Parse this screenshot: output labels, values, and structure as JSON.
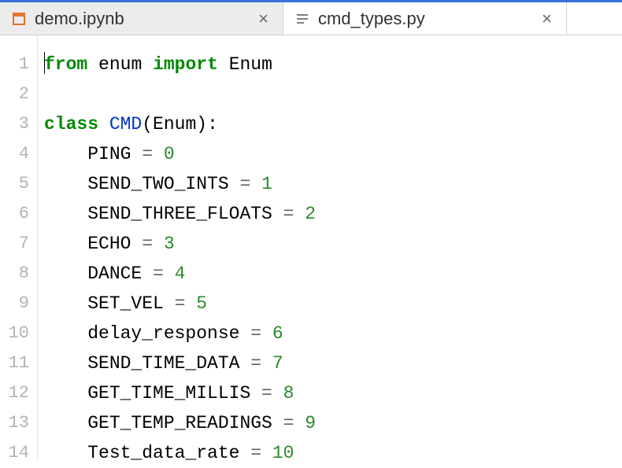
{
  "tabs": [
    {
      "label": "demo.ipynb",
      "active": false
    },
    {
      "label": "cmd_types.py",
      "active": true
    }
  ],
  "code": {
    "lines": [
      {
        "n": 1,
        "tokens": [
          {
            "t": "from",
            "c": "kw"
          },
          {
            "t": " ",
            "c": "id"
          },
          {
            "t": "enum",
            "c": "id"
          },
          {
            "t": " ",
            "c": "id"
          },
          {
            "t": "import",
            "c": "kw"
          },
          {
            "t": " ",
            "c": "id"
          },
          {
            "t": "Enum",
            "c": "id"
          }
        ],
        "cursor_before": true
      },
      {
        "n": 2,
        "tokens": []
      },
      {
        "n": 3,
        "tokens": [
          {
            "t": "class",
            "c": "kw"
          },
          {
            "t": " ",
            "c": "id"
          },
          {
            "t": "CMD",
            "c": "cls"
          },
          {
            "t": "(Enum):",
            "c": "punct"
          }
        ]
      },
      {
        "n": 4,
        "tokens": [
          {
            "t": "    PING ",
            "c": "id"
          },
          {
            "t": "=",
            "c": "op"
          },
          {
            "t": " ",
            "c": "id"
          },
          {
            "t": "0",
            "c": "num"
          }
        ]
      },
      {
        "n": 5,
        "tokens": [
          {
            "t": "    SEND_TWO_INTS ",
            "c": "id"
          },
          {
            "t": "=",
            "c": "op"
          },
          {
            "t": " ",
            "c": "id"
          },
          {
            "t": "1",
            "c": "num"
          }
        ]
      },
      {
        "n": 6,
        "tokens": [
          {
            "t": "    SEND_THREE_FLOATS ",
            "c": "id"
          },
          {
            "t": "=",
            "c": "op"
          },
          {
            "t": " ",
            "c": "id"
          },
          {
            "t": "2",
            "c": "num"
          }
        ]
      },
      {
        "n": 7,
        "tokens": [
          {
            "t": "    ECHO ",
            "c": "id"
          },
          {
            "t": "=",
            "c": "op"
          },
          {
            "t": " ",
            "c": "id"
          },
          {
            "t": "3",
            "c": "num"
          }
        ]
      },
      {
        "n": 8,
        "tokens": [
          {
            "t": "    DANCE ",
            "c": "id"
          },
          {
            "t": "=",
            "c": "op"
          },
          {
            "t": " ",
            "c": "id"
          },
          {
            "t": "4",
            "c": "num"
          }
        ]
      },
      {
        "n": 9,
        "tokens": [
          {
            "t": "    SET_VEL ",
            "c": "id"
          },
          {
            "t": "=",
            "c": "op"
          },
          {
            "t": " ",
            "c": "id"
          },
          {
            "t": "5",
            "c": "num"
          }
        ]
      },
      {
        "n": 10,
        "tokens": [
          {
            "t": "    delay_response ",
            "c": "id"
          },
          {
            "t": "=",
            "c": "op"
          },
          {
            "t": " ",
            "c": "id"
          },
          {
            "t": "6",
            "c": "num"
          }
        ]
      },
      {
        "n": 11,
        "tokens": [
          {
            "t": "    SEND_TIME_DATA ",
            "c": "id"
          },
          {
            "t": "=",
            "c": "op"
          },
          {
            "t": " ",
            "c": "id"
          },
          {
            "t": "7",
            "c": "num"
          }
        ]
      },
      {
        "n": 12,
        "tokens": [
          {
            "t": "    GET_TIME_MILLIS ",
            "c": "id"
          },
          {
            "t": "=",
            "c": "op"
          },
          {
            "t": " ",
            "c": "id"
          },
          {
            "t": "8",
            "c": "num"
          }
        ]
      },
      {
        "n": 13,
        "tokens": [
          {
            "t": "    GET_TEMP_READINGS ",
            "c": "id"
          },
          {
            "t": "=",
            "c": "op"
          },
          {
            "t": " ",
            "c": "id"
          },
          {
            "t": "9",
            "c": "num"
          }
        ]
      },
      {
        "n": 14,
        "tokens": [
          {
            "t": "    Test_data_rate ",
            "c": "id"
          },
          {
            "t": "=",
            "c": "op"
          },
          {
            "t": " ",
            "c": "id"
          },
          {
            "t": "10",
            "c": "num"
          }
        ]
      }
    ]
  }
}
